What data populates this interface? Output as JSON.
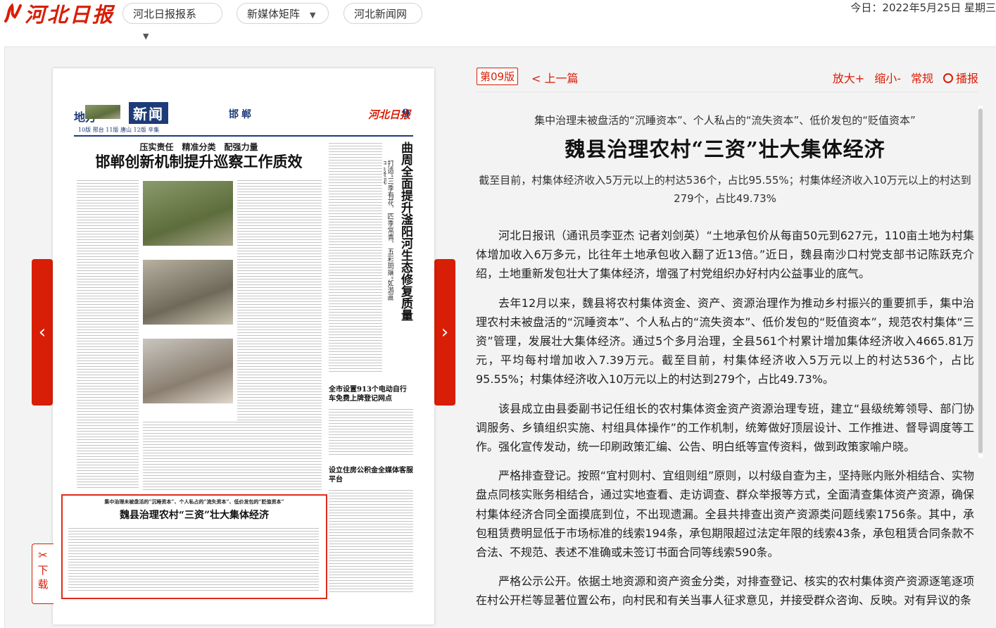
{
  "header": {
    "logo_text": "河北日报",
    "nav": [
      {
        "label": "河北日报报系",
        "has_dropdown": true
      },
      {
        "label": "新媒体矩阵",
        "has_dropdown": true
      },
      {
        "label": "河北新闻网",
        "has_dropdown": false
      }
    ],
    "date_text": "今日：2022年5月25日 星期三"
  },
  "viewer": {
    "prev_arrow": "‹",
    "next_arrow": "›",
    "download_label": "下载",
    "edition_label": "第09版",
    "prev_article": "< 上一篇",
    "zoom_in": "放大+",
    "zoom_out": "缩小-",
    "normal": "常规",
    "broadcast": "播报"
  },
  "newspaper": {
    "section_left": "地方",
    "section_name": "新闻",
    "city": "邯郸",
    "page_num": "9",
    "subline": "10版 邢台  11版 唐山  12版 辛集",
    "top_kicker": "压实责任　精准分类　配强力量",
    "top_headline": "邯郸创新机制提升巡察工作质效",
    "right_headline": "曲周全面提升滏阳河生态修复质量",
    "right_sub": "打造“三季有花、四季常青、五彩斑斓”如游画中”景观",
    "mid_headline": "全市设置913个电动自行车免费上牌登记网点",
    "low_headline": "设立住房公积金全媒体客服平台",
    "boxed_kicker": "集中治理未被盘活的“沉睡资本”、个人私占的“流失资本”、低价发包的“贬值资本”",
    "boxed_headline": "魏县治理农村“三资”壮大集体经济"
  },
  "article": {
    "kicker": "集中治理未被盘活的“沉睡资本”、个人私占的“流失资本”、低价发包的“贬值资本”",
    "title": "魏县治理农村“三资”壮大集体经济",
    "subtitle": "截至目前，村集体经济收入5万元以上的村达536个，占比95.55%；村集体经济收入10万元以上的村达到279个，占比49.73%",
    "paragraphs": [
      "河北日报讯（通讯员李亚杰 记者刘剑英）“土地承包价从每亩50元到627元，110亩土地为村集体增加收入6万多元，比往年土地承包收入翻了近13倍。”近日，魏县南沙口村党支部书记陈跃克介绍，土地重新发包壮大了集体经济，增强了村党组织办好村内公益事业的底气。",
      "去年12月以来，魏县将农村集体资金、资产、资源治理作为推动乡村振兴的重要抓手，集中治理农村未被盘活的“沉睡资本”、个人私占的“流失资本”、低价发包的“贬值资本”，规范农村集体“三资”管理，发展壮大集体经济。通过5个多月治理，全县561个村累计增加集体经济收入4665.81万元，平均每村增加收入7.39万元。截至目前，村集体经济收入5万元以上的村达536个，占比95.55%；村集体经济收入10万元以上的村达到279个，占比49.73%。",
      "该县成立由县委副书记任组长的农村集体资金资产资源治理专班，建立“县级统筹领导、部门协调服务、乡镇组织实施、村组具体操作”的工作机制，统筹做好顶层设计、工作推进、督导调度等工作。强化宣传发动，统一印刷政策汇编、公告、明白纸等宣传资料，做到政策家喻户晓。",
      "严格排查登记。按照“宜村则村、宜组则组”原则，以村级自查为主，坚持账内账外相结合、实物盘点同核实账务相结合，通过实地查看、走访调查、群众举报等方式，全面清查集体资产资源，确保村集体经济合同全面摸底到位，不出现遗漏。全县共排查出资产资源类问题线索1756条。其中，承包租赁费明显低于市场标准的线索194条，承包期限超过法定年限的线索43条，承包租赁合同条款不合法、不规范、表述不准确或未签订书面合同等线索590条。",
      "严格公示公开。依据土地资源和资产资金分类，对排查登记、核实的农村集体资产资源逐笔逐项在村公开栏等显著位置公布，向村民和有关当事人征求意见，并接受群众咨询、反映。对有异议的条"
    ]
  }
}
